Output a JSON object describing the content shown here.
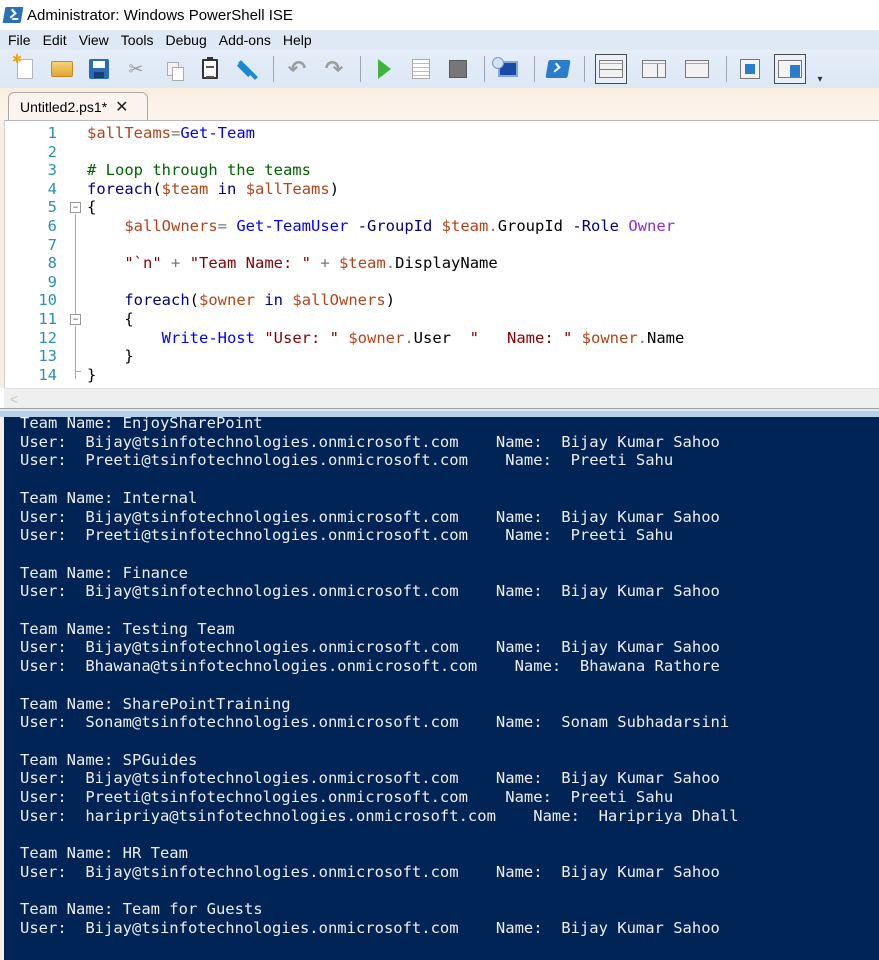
{
  "window": {
    "title": "Administrator: Windows PowerShell ISE",
    "icon": "powershell-icon"
  },
  "menu": [
    "File",
    "Edit",
    "View",
    "Tools",
    "Debug",
    "Add-ons",
    "Help"
  ],
  "toolbar": {
    "buttons": [
      {
        "name": "new-script",
        "icon": "new-file-icon"
      },
      {
        "name": "open-script",
        "icon": "folder-open-icon"
      },
      {
        "name": "save-script",
        "icon": "floppy-disk-icon"
      },
      {
        "name": "cut",
        "icon": "scissors-icon"
      },
      {
        "name": "copy",
        "icon": "copy-icon"
      },
      {
        "name": "paste",
        "icon": "clipboard-icon"
      },
      {
        "name": "clear-console",
        "icon": "eraser-icon"
      },
      {
        "name": "undo",
        "icon": "undo-icon"
      },
      {
        "name": "redo",
        "icon": "redo-icon"
      },
      {
        "name": "run-script",
        "icon": "play-icon"
      },
      {
        "name": "run-selection",
        "icon": "run-selection-icon"
      },
      {
        "name": "stop-operation",
        "icon": "stop-icon"
      },
      {
        "name": "new-remote-tab",
        "icon": "remote-computer-icon"
      },
      {
        "name": "start-powershell",
        "icon": "powershell-icon"
      },
      {
        "name": "script-pane-top",
        "icon": "pane-top-icon",
        "pressed": true
      },
      {
        "name": "script-pane-right",
        "icon": "pane-right-icon"
      },
      {
        "name": "script-pane-maximized",
        "icon": "pane-max-icon"
      },
      {
        "name": "show-script-pane",
        "icon": "show-script-pane-icon"
      },
      {
        "name": "show-command-addon",
        "icon": "command-addon-icon",
        "pressed": true
      }
    ]
  },
  "tab": {
    "label": "Untitled2.ps1*",
    "close_glyph": "✕"
  },
  "editor": {
    "lines": [
      {
        "n": "1",
        "tokens": [
          [
            "var",
            "$allTeams"
          ],
          [
            "op",
            "="
          ],
          [
            "cmd",
            "Get-Team"
          ]
        ]
      },
      {
        "n": "2",
        "tokens": []
      },
      {
        "n": "3",
        "tokens": [
          [
            "com",
            "# Loop through the teams"
          ]
        ]
      },
      {
        "n": "4",
        "tokens": [
          [
            "kw",
            "foreach"
          ],
          [
            "grp",
            "("
          ],
          [
            "var",
            "$team"
          ],
          [
            "grp",
            " "
          ],
          [
            "kw",
            "in"
          ],
          [
            "grp",
            " "
          ],
          [
            "var",
            "$allTeams"
          ],
          [
            "grp",
            ")"
          ]
        ]
      },
      {
        "n": "5",
        "tokens": [
          [
            "grp",
            "{"
          ]
        ]
      },
      {
        "n": "6",
        "tokens": [
          [
            "grp",
            "    "
          ],
          [
            "var",
            "$allOwners"
          ],
          [
            "op",
            "="
          ],
          [
            "grp",
            " "
          ],
          [
            "cmd",
            "Get-TeamUser"
          ],
          [
            "grp",
            " "
          ],
          [
            "param",
            "-GroupId"
          ],
          [
            "grp",
            " "
          ],
          [
            "var",
            "$team"
          ],
          [
            "op",
            "."
          ],
          [
            "mem",
            "GroupId"
          ],
          [
            "grp",
            " "
          ],
          [
            "param",
            "-Role"
          ],
          [
            "grp",
            " "
          ],
          [
            "arg",
            "Owner"
          ]
        ]
      },
      {
        "n": "7",
        "tokens": []
      },
      {
        "n": "8",
        "tokens": [
          [
            "grp",
            "    "
          ],
          [
            "str",
            "\"`n\""
          ],
          [
            "grp",
            " "
          ],
          [
            "op",
            "+"
          ],
          [
            "grp",
            " "
          ],
          [
            "str",
            "\"Team Name: \""
          ],
          [
            "grp",
            " "
          ],
          [
            "op",
            "+"
          ],
          [
            "grp",
            " "
          ],
          [
            "var",
            "$team"
          ],
          [
            "op",
            "."
          ],
          [
            "mem",
            "DisplayName"
          ]
        ]
      },
      {
        "n": "9",
        "tokens": []
      },
      {
        "n": "10",
        "tokens": [
          [
            "grp",
            "    "
          ],
          [
            "kw",
            "foreach"
          ],
          [
            "grp",
            "("
          ],
          [
            "var",
            "$owner"
          ],
          [
            "grp",
            " "
          ],
          [
            "kw",
            "in"
          ],
          [
            "grp",
            " "
          ],
          [
            "var",
            "$allOwners"
          ],
          [
            "grp",
            ")"
          ]
        ]
      },
      {
        "n": "11",
        "tokens": [
          [
            "grp",
            "    {"
          ]
        ]
      },
      {
        "n": "12",
        "tokens": [
          [
            "grp",
            "        "
          ],
          [
            "cmd",
            "Write-Host"
          ],
          [
            "grp",
            " "
          ],
          [
            "str",
            "\"User: \""
          ],
          [
            "grp",
            " "
          ],
          [
            "var",
            "$owner"
          ],
          [
            "op",
            "."
          ],
          [
            "mem",
            "User"
          ],
          [
            "grp",
            "  "
          ],
          [
            "str",
            "\"   Name: \""
          ],
          [
            "grp",
            " "
          ],
          [
            "var",
            "$owner"
          ],
          [
            "op",
            "."
          ],
          [
            "mem",
            "Name"
          ]
        ]
      },
      {
        "n": "13",
        "tokens": [
          [
            "grp",
            "    }"
          ]
        ]
      },
      {
        "n": "14",
        "tokens": [
          [
            "grp",
            "}"
          ]
        ]
      }
    ]
  },
  "console": {
    "lines": [
      "Team Name: EnjoySharePoint",
      "User:  Bijay@tsinfotechnologies.onmicrosoft.com    Name:  Bijay Kumar Sahoo",
      "User:  Preeti@tsinfotechnologies.onmicrosoft.com    Name:  Preeti Sahu",
      "",
      "Team Name: Internal",
      "User:  Bijay@tsinfotechnologies.onmicrosoft.com    Name:  Bijay Kumar Sahoo",
      "User:  Preeti@tsinfotechnologies.onmicrosoft.com    Name:  Preeti Sahu",
      "",
      "Team Name: Finance",
      "User:  Bijay@tsinfotechnologies.onmicrosoft.com    Name:  Bijay Kumar Sahoo",
      "",
      "Team Name: Testing Team",
      "User:  Bijay@tsinfotechnologies.onmicrosoft.com    Name:  Bijay Kumar Sahoo",
      "User:  Bhawana@tsinfotechnologies.onmicrosoft.com    Name:  Bhawana Rathore",
      "",
      "Team Name: SharePointTraining",
      "User:  Sonam@tsinfotechnologies.onmicrosoft.com    Name:  Sonam Subhadarsini",
      "",
      "Team Name: SPGuides",
      "User:  Bijay@tsinfotechnologies.onmicrosoft.com    Name:  Bijay Kumar Sahoo",
      "User:  Preeti@tsinfotechnologies.onmicrosoft.com    Name:  Preeti Sahu",
      "User:  haripriya@tsinfotechnologies.onmicrosoft.com    Name:  Haripriya Dhall",
      "",
      "Team Name: HR Team",
      "User:  Bijay@tsinfotechnologies.onmicrosoft.com    Name:  Bijay Kumar Sahoo",
      "",
      "Team Name: Team for Guests",
      "User:  Bijay@tsinfotechnologies.onmicrosoft.com    Name:  Bijay Kumar Sahoo",
      ""
    ]
  },
  "colors": {
    "console_bg": "#012456",
    "console_fg": "#eeedf0",
    "line_number": "#2b91af",
    "variable": "#b5431a",
    "command": "#0000ff",
    "keyword": "#00008b",
    "comment": "#006400",
    "string": "#8b0000",
    "argument": "#8a2be2"
  }
}
